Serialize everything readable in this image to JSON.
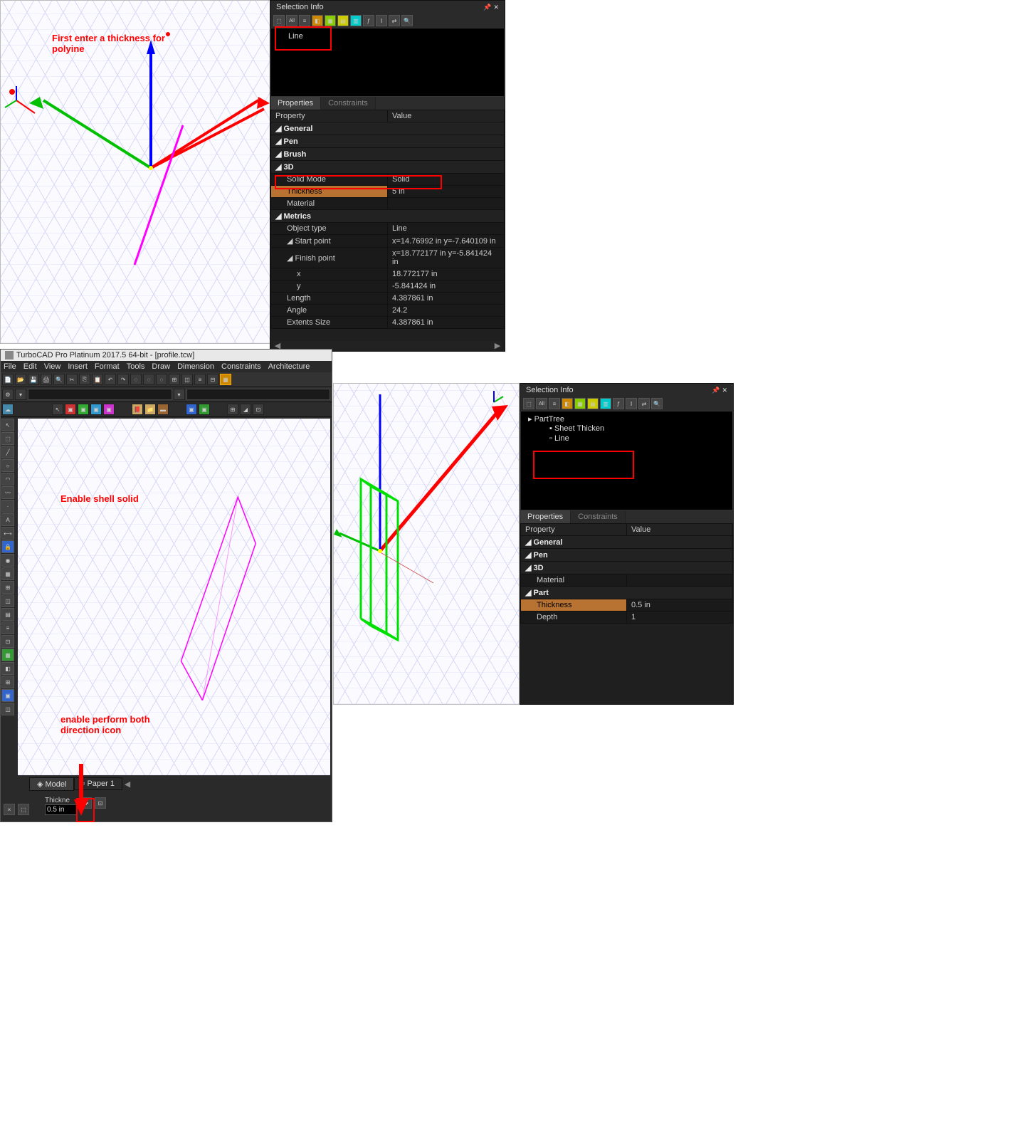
{
  "top": {
    "selection_info": {
      "title": "Selection Info",
      "tree_item": "Line"
    },
    "properties_tabs": {
      "active": "Properties",
      "inactive": "Constraints"
    },
    "prop_headers": {
      "property": "Property",
      "value": "Value"
    },
    "groups": {
      "general": "General",
      "pen": "Pen",
      "brush": "Brush",
      "threeD": "3D",
      "metrics": "Metrics"
    },
    "rows": {
      "solidMode": {
        "label": "Solid Mode",
        "value": "Solid"
      },
      "thickness": {
        "label": "Thickness",
        "value": "5 in"
      },
      "material": {
        "label": "Material",
        "value": ""
      },
      "objectType": {
        "label": "Object type",
        "value": "Line"
      },
      "startPoint": {
        "label": "Start point",
        "value": "x=14.76992 in y=-7.640109 in"
      },
      "finishPoint": {
        "label": "Finish point",
        "value": "x=18.772177 in y=-5.841424 in"
      },
      "x": {
        "label": "x",
        "value": "18.772177 in"
      },
      "y": {
        "label": "y",
        "value": "-5.841424 in"
      },
      "length": {
        "label": "Length",
        "value": "4.387861 in"
      },
      "angle": {
        "label": "Angle",
        "value": "24.2"
      },
      "extents": {
        "label": "Extents Size",
        "value": "4.387861 in"
      }
    },
    "annotation": "First enter a thickness for polyine"
  },
  "bottom_left": {
    "window_title": "TurboCAD Pro Platinum 2017.5 64-bit - [profile.tcw]",
    "menu": [
      "File",
      "Edit",
      "View",
      "Insert",
      "Format",
      "Tools",
      "Draw",
      "Dimension",
      "Constraints",
      "Architecture"
    ],
    "note1": "Enable shell solid",
    "note2": "enable perform both direction icon",
    "tabs_bottom": {
      "model": "Model",
      "paper": "Paper 1"
    },
    "thickne_label": "Thickne",
    "thickne_value": "0.5 in"
  },
  "bottom_right": {
    "selection_info": {
      "title": "Selection Info"
    },
    "tree": {
      "root": "PartTree",
      "child1": "Sheet Thicken",
      "child2": "Line"
    },
    "properties_tabs": {
      "active": "Properties",
      "inactive": "Constraints"
    },
    "prop_headers": {
      "property": "Property",
      "value": "Value"
    },
    "groups": {
      "general": "General",
      "pen": "Pen",
      "threeD": "3D",
      "part": "Part"
    },
    "rows": {
      "material": {
        "label": "Material",
        "value": ""
      },
      "thickness": {
        "label": "Thickness",
        "value": "0.5 in"
      },
      "depth": {
        "label": "Depth",
        "value": "1"
      }
    }
  }
}
